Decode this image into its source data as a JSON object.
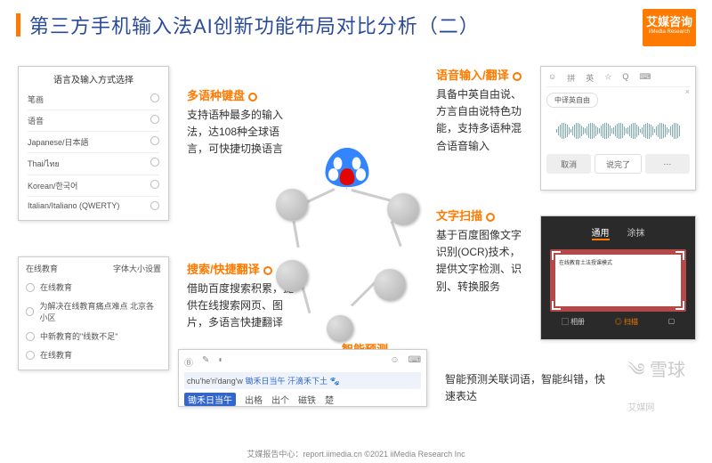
{
  "header": {
    "title": "第三方手机输入法AI创新功能布局对比分析（二）"
  },
  "logo": {
    "cn": "艾媒咨询",
    "en": "iiMedia Research"
  },
  "sections": {
    "multilang": {
      "title": "多语种键盘",
      "desc": "支持语种最多的输入法，达108种全球语言，可快捷切换语言"
    },
    "voice": {
      "title": "语音输入/翻译",
      "desc": "具备中英自由说、方言自由说特色功能，支持多语种混合语音输入"
    },
    "ocr": {
      "title": "文字扫描",
      "desc": "基于百度图像文字识别(OCR)技术，提供文字检测、识别、转换服务"
    },
    "search": {
      "title": "搜索/快捷翻译",
      "desc": "借助百度搜索积累，提供在线搜索网页、图片，多语言快捷翻译"
    },
    "predict": {
      "title": "智能预测",
      "desc": "智能预测关联词语，智能纠错，快速表达"
    }
  },
  "langCard": {
    "title": "语言及输入方式选择",
    "items": [
      "笔画",
      "语音",
      "Japanese/日本語",
      "Thai/ไทย",
      "Korean/한국어",
      "Italian/Italiano (QWERTY)"
    ]
  },
  "searchCard": {
    "tab1": "在线教育",
    "tab2": "字体大小设置",
    "rows": [
      "在线教育",
      "为解决在线教育痛点难点 北京各小区",
      "中新教育的\"线数不足\"",
      "在线教育"
    ]
  },
  "voiceCard": {
    "tabs": [
      "☺",
      "拼",
      "英",
      "☆",
      "Q",
      "⌨"
    ],
    "pill": "中译英自由",
    "done": "说完了",
    "cancel": "取消"
  },
  "ocrCard": {
    "tabs": [
      "通用",
      "涂抹"
    ],
    "innerTitle": "在线教育土法授课模式",
    "btm1": "相册",
    "btm2": "扫描"
  },
  "inputCard": {
    "pinyin": "chu'he'ri'dang'w",
    "suggestion": "锄禾日当午 汗滴禾下土",
    "cands": [
      "锄禾日当午",
      "出格",
      "出个",
      "磁铁",
      "楚"
    ]
  },
  "footer": "艾媒报告中心：report.iimedia.cn   ©2021 iiMedia Research Inc",
  "watermark": {
    "main": "雪球",
    "sub": "艾媒网"
  }
}
